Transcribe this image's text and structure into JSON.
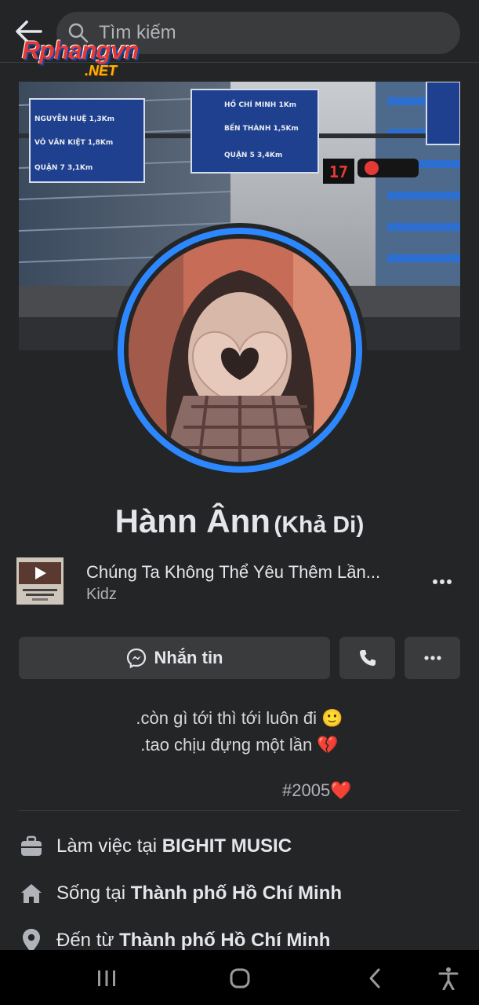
{
  "header": {
    "search_placeholder": "Tìm kiếm"
  },
  "watermark": {
    "brand": "Rphangvn",
    "suffix": ".NET"
  },
  "profile": {
    "name": "Hànn Ânn",
    "alternate_name": "(Khả Di)"
  },
  "music": {
    "song_title": "Chúng Ta Không Thể Yêu Thêm Lần...",
    "artist": "Kidz",
    "album_art_text": "CHÚNG TA KHÔNG THỂ YÊU THÊM LẦN NỮA"
  },
  "actions": {
    "message_label": "Nhắn tin"
  },
  "bio": {
    "line1": ".còn gì tới thì tới luôn đi 🙂",
    "line2": ".tao chịu đựng một lần 💔",
    "hashtag": "#2005",
    "hashtag_emoji": "❤️"
  },
  "details": {
    "work_prefix": "Làm việc tại ",
    "work_value": "BIGHIT MUSIC",
    "live_prefix": "Sống tại ",
    "live_value": "Thành phố Hồ Chí Minh",
    "from_prefix": "Đến từ ",
    "from_value": "Thành phố Hồ Chí Minh"
  },
  "colors": {
    "background": "#242526",
    "button": "#3a3b3c",
    "accent_blue": "#2d88ff",
    "text_primary": "#e4e6eb",
    "text_secondary": "#b0b3b8"
  }
}
